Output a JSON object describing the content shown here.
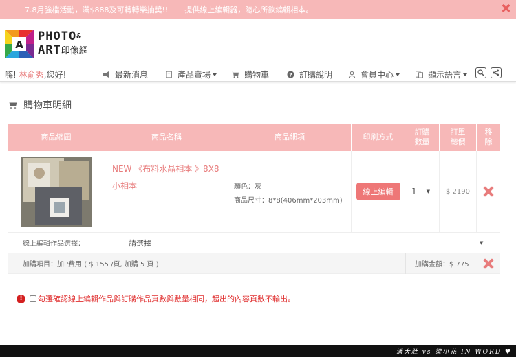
{
  "promo": {
    "text1": "7.8月強檔活動，滿$888及可轉轉樂抽獎!!",
    "text2": "提供線上編輯器，隨心所欲編輯相本。"
  },
  "logo": {
    "line1": "PHOTO",
    "amp": "&",
    "line2": "ART",
    "cn": "印像網"
  },
  "nav": {
    "greeting_prefix": "嗨!",
    "username": "林俞秀",
    "greeting_suffix": ",您好!",
    "items": [
      {
        "label": "最新消息",
        "icon": "megaphone-icon"
      },
      {
        "label": "產品賣場",
        "icon": "book-icon"
      },
      {
        "label": "購物車",
        "icon": "cart-icon"
      },
      {
        "label": "訂購說明",
        "icon": "question-icon"
      },
      {
        "label": "會員中心",
        "icon": "user-icon"
      },
      {
        "label": "顯示語言",
        "icon": "translate-icon"
      }
    ]
  },
  "page_title": "購物車明細",
  "table": {
    "headers": [
      "商品縮圖",
      "商品名稱",
      "商品細項",
      "印刷方式",
      "訂購\n數量",
      "訂單\n總價",
      "移\n除"
    ],
    "item": {
      "name": "NEW 《布料水晶相本 》8X8小相本",
      "color": "顏色：灰",
      "size": "商品尺寸：8*8(406mm*203mm)",
      "print_button": "線上編輯",
      "quantity": "1",
      "price": "$ 2190"
    },
    "select_label": "線上編輯作品選擇：",
    "select_value": "請選擇",
    "addon_label": "加購項目：加P費用 ( $ 155 /頁, 加購 5 頁 )",
    "addon_total": "加購金額：$ 775"
  },
  "warning": "勾選確認線上編輯作品與訂購作品頁數與數量相同，超出的內容頁數不輸出。",
  "footer_watermark": "潘大肚 vs 梁小花 IN WORD ♥",
  "colors": {
    "accent": "#f7b8b8",
    "button": "#ee7777",
    "link": "#e87c7c",
    "warning": "#e03030"
  }
}
